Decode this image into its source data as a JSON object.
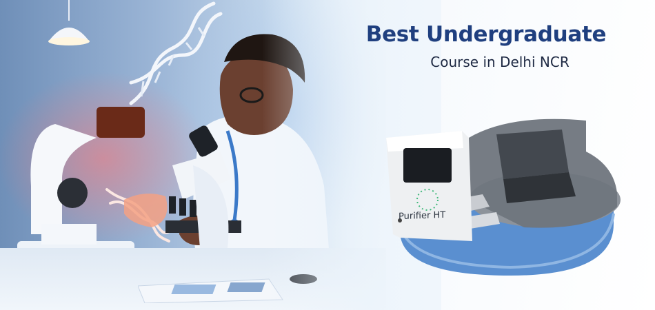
{
  "headline": {
    "title": "Best Undergraduate",
    "subtitle": "Course in Delhi NCR"
  },
  "instrument": {
    "label": "Purifier HT"
  },
  "colors": {
    "title": "#1f3f7f",
    "subtitle": "#1f2a44",
    "instrument_base": "#5a8fd0",
    "background": "#f4f8fc"
  }
}
